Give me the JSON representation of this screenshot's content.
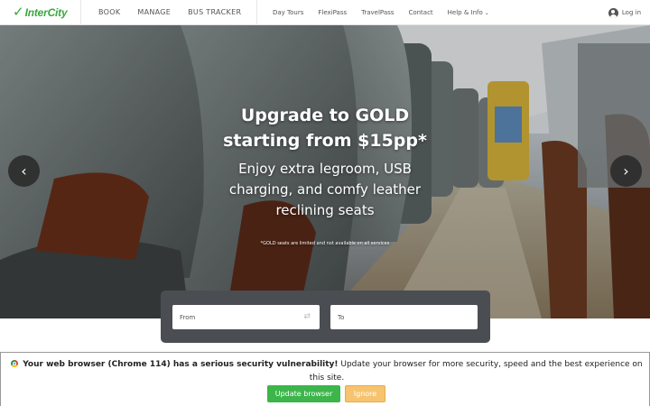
{
  "header": {
    "logo_text": "InterCity",
    "main_nav": [
      "BOOK",
      "MANAGE",
      "BUS TRACKER"
    ],
    "secondary_nav": [
      "Day Tours",
      "FlexiPass",
      "TravelPass",
      "Contact",
      "Help & Info"
    ],
    "login_label": "Log in"
  },
  "hero": {
    "headline_line1": "Upgrade to GOLD",
    "headline_line2": "starting from $15pp*",
    "sub_line1": "Enjoy extra legroom, USB",
    "sub_line2": "charging, and comfy leather",
    "sub_line3": "reclining seats",
    "disclaimer": "*GOLD seats are limited and not available on all services",
    "prev_glyph": "‹",
    "next_glyph": "›"
  },
  "search": {
    "from_placeholder": "From",
    "to_placeholder": "To",
    "swap_glyph": "⇄"
  },
  "banner": {
    "bold_text": "Your web browser (Chrome 114) has a serious security vulnerability!",
    "text": " Update your browser for more security, speed and the best experience on this site.",
    "update_label": "Update browser",
    "ignore_label": "Ignore"
  },
  "colors": {
    "brand_green": "#3aa83f",
    "search_panel": "#4a4e52",
    "update_button": "#3cb54a",
    "ignore_button": "#f7c36e"
  }
}
